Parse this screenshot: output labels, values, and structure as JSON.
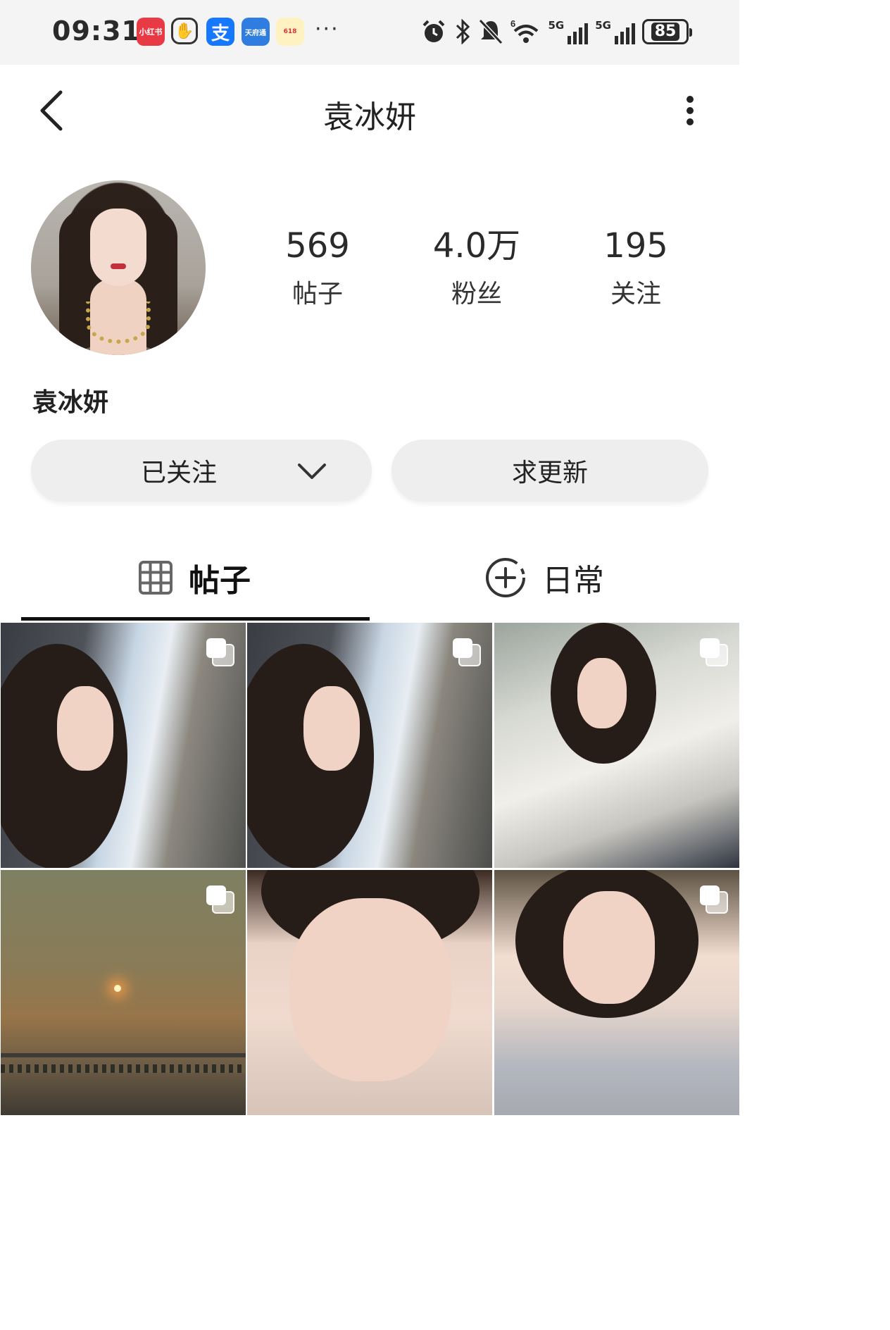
{
  "status_bar": {
    "time": "09:31",
    "apps": [
      "小红书",
      "✋",
      "支",
      "天府通",
      "618"
    ],
    "more": "···",
    "network_labels": [
      "6",
      "5G",
      "5G"
    ],
    "battery": "85"
  },
  "header": {
    "title": "袁冰妍"
  },
  "profile": {
    "name": "袁冰妍",
    "stats": [
      {
        "value": "569",
        "label": "帖子"
      },
      {
        "value": "4.0万",
        "label": "粉丝"
      },
      {
        "value": "195",
        "label": "关注"
      }
    ],
    "follow_button": "已关注",
    "update_button": "求更新"
  },
  "tabs": [
    {
      "label": "帖子",
      "icon": "grid-icon",
      "active": true
    },
    {
      "label": "日常",
      "icon": "add-circle-icon",
      "active": false
    }
  ],
  "posts": [
    {
      "subject": "car-window-portrait",
      "multi": true
    },
    {
      "subject": "car-window-portrait",
      "multi": true
    },
    {
      "subject": "white-shirt-car-seat",
      "multi": true
    },
    {
      "subject": "sunset-over-water",
      "multi": true
    },
    {
      "subject": "hand-on-cheek-selfie",
      "multi": false
    },
    {
      "subject": "grey-sweater-portrait",
      "multi": true
    }
  ],
  "colors": {
    "button_bg": "#eeeeee",
    "text": "#222222",
    "status_bar_bg": "#f4f4f4"
  }
}
